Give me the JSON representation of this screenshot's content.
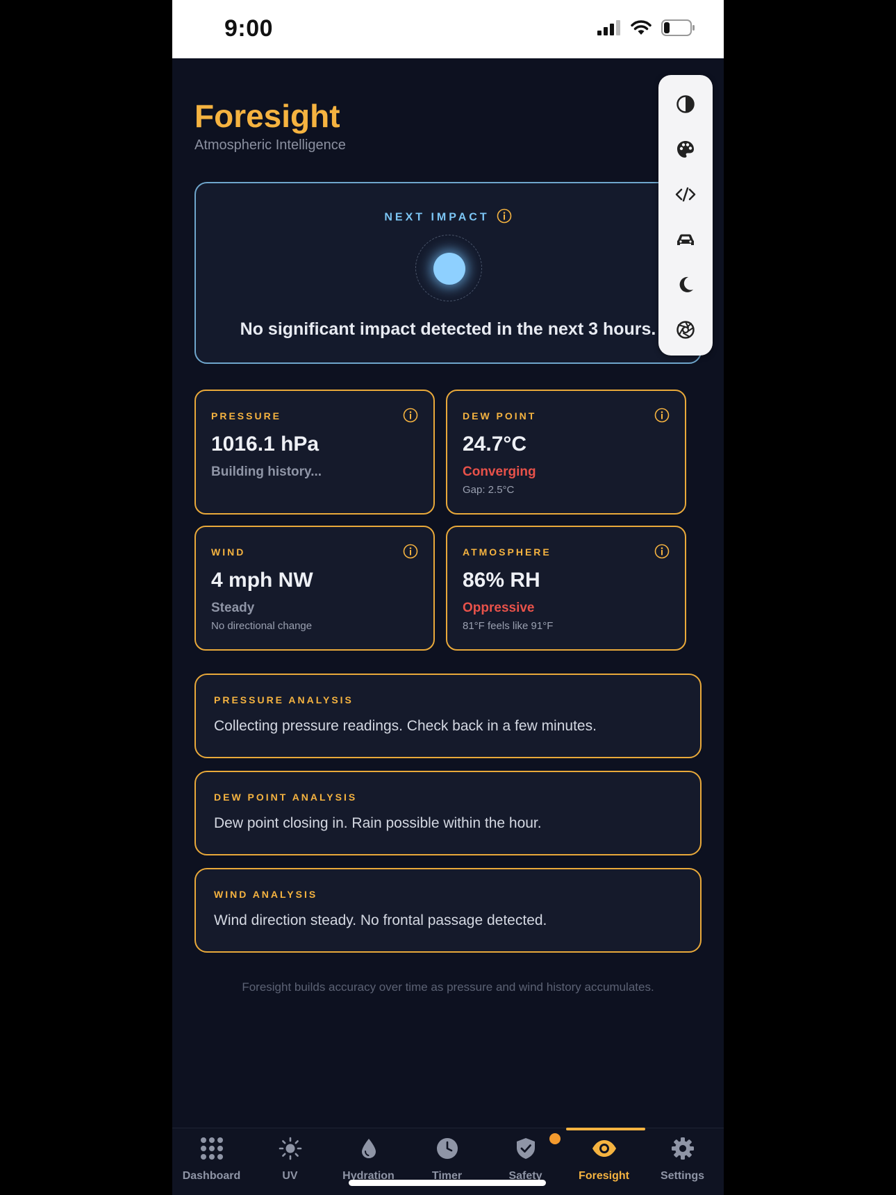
{
  "status_bar": {
    "time": "9:00"
  },
  "header": {
    "title": "Foresight",
    "subtitle": "Atmospheric Intelligence"
  },
  "next_impact": {
    "label": "NEXT IMPACT",
    "message": "No significant impact detected in the next 3 hours."
  },
  "toolbar": {
    "tools": [
      "contrast-icon",
      "palette-icon",
      "code-icon",
      "car-icon",
      "moon-icon",
      "aperture-icon"
    ]
  },
  "metrics": {
    "pressure": {
      "label": "PRESSURE",
      "value": "1016.1 hPa",
      "status": "Building history...",
      "detail": ""
    },
    "dew_point": {
      "label": "DEW POINT",
      "value": "24.7°C",
      "status": "Converging",
      "detail": "Gap: 2.5°C"
    },
    "wind": {
      "label": "WIND",
      "value": "4 mph NW",
      "status": "Steady",
      "detail": "No directional change"
    },
    "atmosphere": {
      "label": "ATMOSPHERE",
      "value": "86% RH",
      "status": "Oppressive",
      "detail": "81°F feels like 91°F"
    }
  },
  "analysis": {
    "pressure": {
      "label": "PRESSURE ANALYSIS",
      "text": "Collecting pressure readings. Check back in a few minutes."
    },
    "dew_point": {
      "label": "DEW POINT ANALYSIS",
      "text": "Dew point closing in. Rain possible within the hour."
    },
    "wind": {
      "label": "WIND ANALYSIS",
      "text": "Wind direction steady. No frontal passage detected."
    }
  },
  "footnote": "Foresight builds accuracy over time as pressure and wind history accumulates.",
  "tabs": [
    {
      "label": "Dashboard",
      "icon": "grid-icon"
    },
    {
      "label": "UV",
      "icon": "sun-icon"
    },
    {
      "label": "Hydration",
      "icon": "drop-icon"
    },
    {
      "label": "Timer",
      "icon": "clock-icon"
    },
    {
      "label": "Safety",
      "icon": "shield-icon"
    },
    {
      "label": "Foresight",
      "icon": "eye-icon",
      "active": true
    },
    {
      "label": "Settings",
      "icon": "gear-icon"
    }
  ],
  "colors": {
    "accent": "#f5b340",
    "impact_accent": "#7cc6f5",
    "warning": "#e8524a",
    "background": "#0d1120",
    "badge": "#f39a2e"
  }
}
